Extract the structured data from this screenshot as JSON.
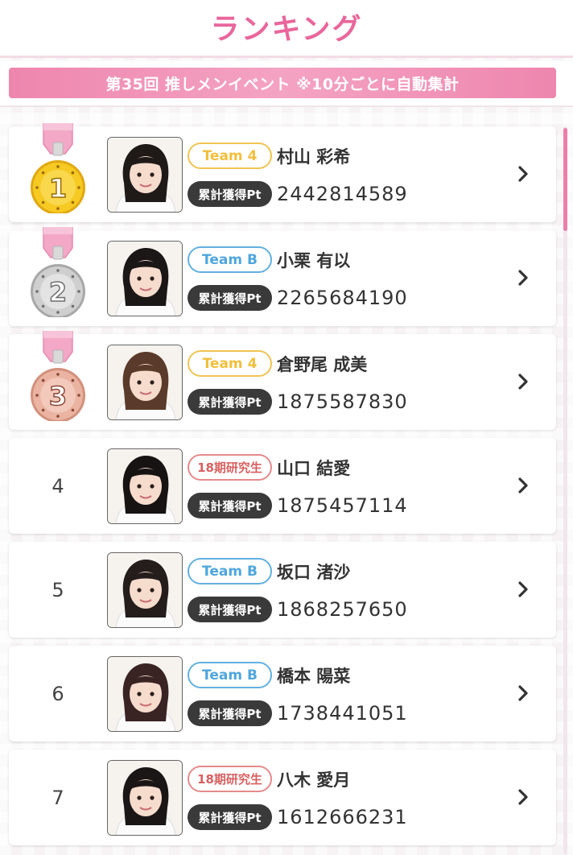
{
  "header": {
    "title": "ランキング"
  },
  "banner": {
    "text": "第35回 推しメンイベント ※10分ごとに自動集計"
  },
  "pt_label": "累計獲得Pt",
  "colors": {
    "accent": "#e9669b",
    "banner": "#ee86ae",
    "gold": "#f4c21f",
    "silver": "#bdbdbd",
    "bronze": "#e7a592",
    "team4": "#f0c452",
    "teamB": "#62b0e0",
    "kenkyusei": "#e58a8a"
  },
  "rankings": [
    {
      "rank": "1",
      "medal": "gold",
      "team": "Team 4",
      "team_class": "t4",
      "name": "村山 彩希",
      "points": "2442814589"
    },
    {
      "rank": "2",
      "medal": "silver",
      "team": "Team B",
      "team_class": "tb",
      "name": "小栗 有以",
      "points": "2265684190"
    },
    {
      "rank": "3",
      "medal": "bronze",
      "team": "Team 4",
      "team_class": "t4",
      "name": "倉野尾 成美",
      "points": "1875587830"
    },
    {
      "rank": "4",
      "medal": null,
      "team": "18期研究生",
      "team_class": "k18",
      "name": "山口 結愛",
      "points": "1875457114"
    },
    {
      "rank": "5",
      "medal": null,
      "team": "Team B",
      "team_class": "tb",
      "name": "坂口 渚沙",
      "points": "1868257650"
    },
    {
      "rank": "6",
      "medal": null,
      "team": "Team B",
      "team_class": "tb",
      "name": "橋本 陽菜",
      "points": "1738441051"
    },
    {
      "rank": "7",
      "medal": null,
      "team": "18期研究生",
      "team_class": "k18",
      "name": "八木 愛月",
      "points": "1612666231"
    }
  ]
}
